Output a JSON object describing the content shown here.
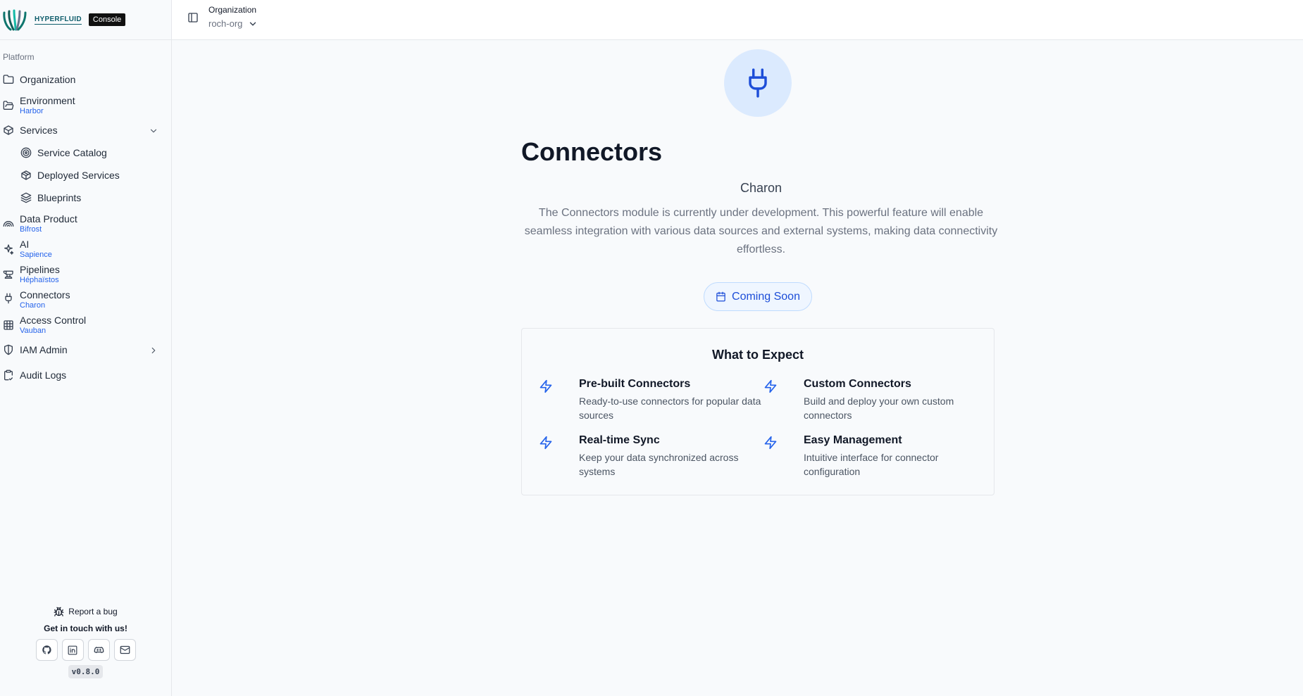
{
  "brand": {
    "name": "HYPERFLUID",
    "badge": "Console",
    "primary_color": "#2563eb"
  },
  "sidebar": {
    "section_label": "Platform",
    "items": [
      {
        "label": "Organization",
        "sub": "",
        "icon": "folder-icon"
      },
      {
        "label": "Environment",
        "sub": "Harbor",
        "icon": "folder-open-icon"
      },
      {
        "label": "Services",
        "sub": "",
        "icon": "package-icon",
        "expanded": true
      },
      {
        "label": "Service Catalog",
        "sub": "",
        "icon": "target-icon"
      },
      {
        "label": "Deployed Services",
        "sub": "",
        "icon": "box-icon"
      },
      {
        "label": "Blueprints",
        "sub": "",
        "icon": "layers-icon"
      },
      {
        "label": "Data Product",
        "sub": "Bifrost",
        "icon": "rainbow-icon"
      },
      {
        "label": "AI",
        "sub": "Sapience",
        "icon": "sparkles-icon"
      },
      {
        "label": "Pipelines",
        "sub": "Héphaïstos",
        "icon": "anvil-icon"
      },
      {
        "label": "Connectors",
        "sub": "Charon",
        "icon": "plug-icon"
      },
      {
        "label": "Access Control",
        "sub": "Vauban",
        "icon": "grid-icon"
      },
      {
        "label": "IAM Admin",
        "sub": "",
        "icon": "shield-icon",
        "expanded": false
      },
      {
        "label": "Audit Logs",
        "sub": "",
        "icon": "clipboard-icon"
      }
    ],
    "footer": {
      "report_bug": "Report a bug",
      "contact": "Get in touch with us!",
      "version": "v0.8.0"
    }
  },
  "header": {
    "org_label": "Organization",
    "org_value": "roch-org"
  },
  "main": {
    "title": "Connectors",
    "module": "Charon",
    "description": "The Connectors module is currently under development. This powerful feature will enable seamless integration with various data sources and external systems, making data connectivity effortless.",
    "status_button": "Coming Soon",
    "expect": {
      "title": "What to Expect",
      "features": [
        {
          "title": "Pre-built Connectors",
          "desc": "Ready-to-use connectors for popular data sources"
        },
        {
          "title": "Custom Connectors",
          "desc": "Build and deploy your own custom connectors"
        },
        {
          "title": "Real-time Sync",
          "desc": "Keep your data synchronized across systems"
        },
        {
          "title": "Easy Management",
          "desc": "Intuitive interface for connector configuration"
        }
      ]
    }
  }
}
